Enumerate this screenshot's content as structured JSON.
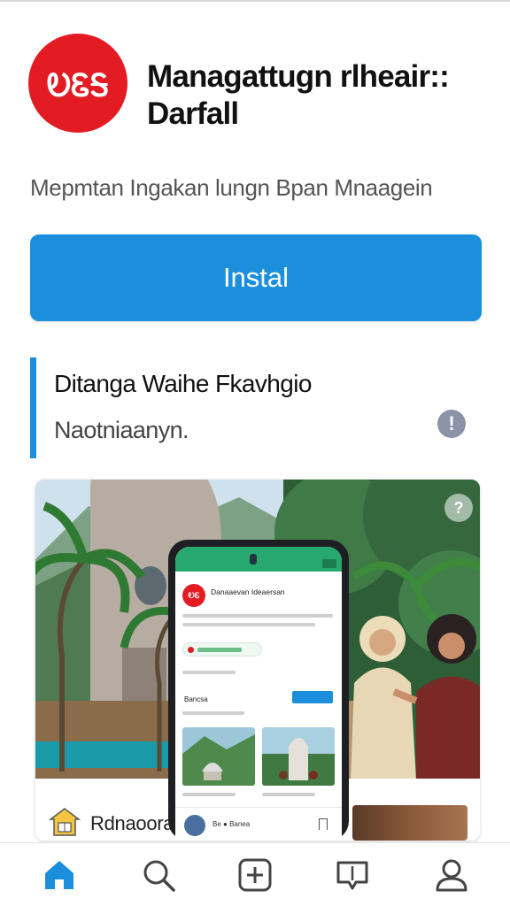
{
  "app": {
    "title": "Managattugn rlheair:: Darfall",
    "logo_text": "ᎧᏋᎦ",
    "subtitle": "Mepmtan Ingakan lungn Bpan Mnaagein",
    "brand_color": "#e31b23",
    "accent_color": "#1b8fdc"
  },
  "install": {
    "label": "Instal"
  },
  "info": {
    "title": "Ditanga Waihe Fkavhgio",
    "text": "Naotniaanyn.",
    "icon": "alert-circle-icon"
  },
  "screenshot": {
    "corner_icon": "info-badge-icon",
    "card_label": "Rdnaoorar",
    "phone": {
      "app_title": "Danaaevan Ideaersan",
      "logo_text": "ᎧᏋ",
      "section_label": "Bancsa",
      "bottom_text": "Be ● Banea"
    }
  },
  "bottom_nav": {
    "items": [
      {
        "icon": "home-icon",
        "active": true
      },
      {
        "icon": "search-icon",
        "active": false
      },
      {
        "icon": "add-square-icon",
        "active": false
      },
      {
        "icon": "chat-icon",
        "active": false
      },
      {
        "icon": "profile-icon",
        "active": false
      }
    ]
  }
}
